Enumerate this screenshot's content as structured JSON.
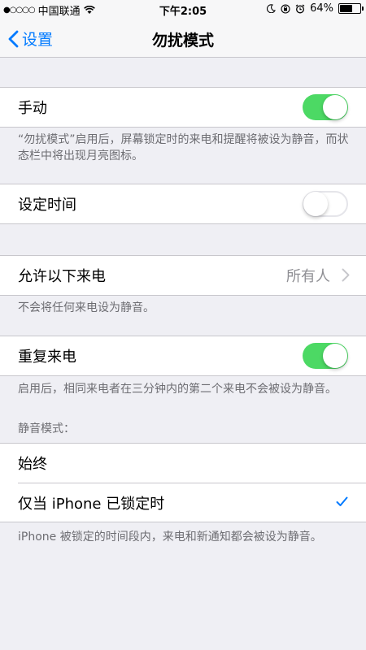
{
  "status_bar": {
    "signal": "●○○○○",
    "carrier": "中国联通",
    "time": "下午2:05",
    "battery": "64%",
    "battery_level": 0.64
  },
  "nav": {
    "back_label": "设置",
    "title": "勿扰模式"
  },
  "manual": {
    "label": "手动",
    "enabled": true,
    "footnote": "“勿扰模式”启用后，屏幕锁定时的来电和提醒将被设为静音，而状态栏中将出现月亮图标。"
  },
  "scheduled": {
    "label": "设定时间",
    "enabled": false
  },
  "allow_calls": {
    "label": "允许以下来电",
    "value": "所有人",
    "footnote": "不会将任何来电设为静音。"
  },
  "repeated_calls": {
    "label": "重复来电",
    "enabled": true,
    "footnote": "启用后，相同来电者在三分钟内的第二个来电不会被设为静音。"
  },
  "silence": {
    "header": "静音模式：",
    "options": [
      {
        "label": "始终",
        "selected": false
      },
      {
        "label": "仅当 iPhone 已锁定时",
        "selected": true
      }
    ],
    "footnote": "iPhone 被锁定的时间段内，来电和新通知都会被设为静音。"
  },
  "colors": {
    "accent": "#007aff",
    "switch_on": "#4cd964",
    "background": "#efeff4"
  }
}
